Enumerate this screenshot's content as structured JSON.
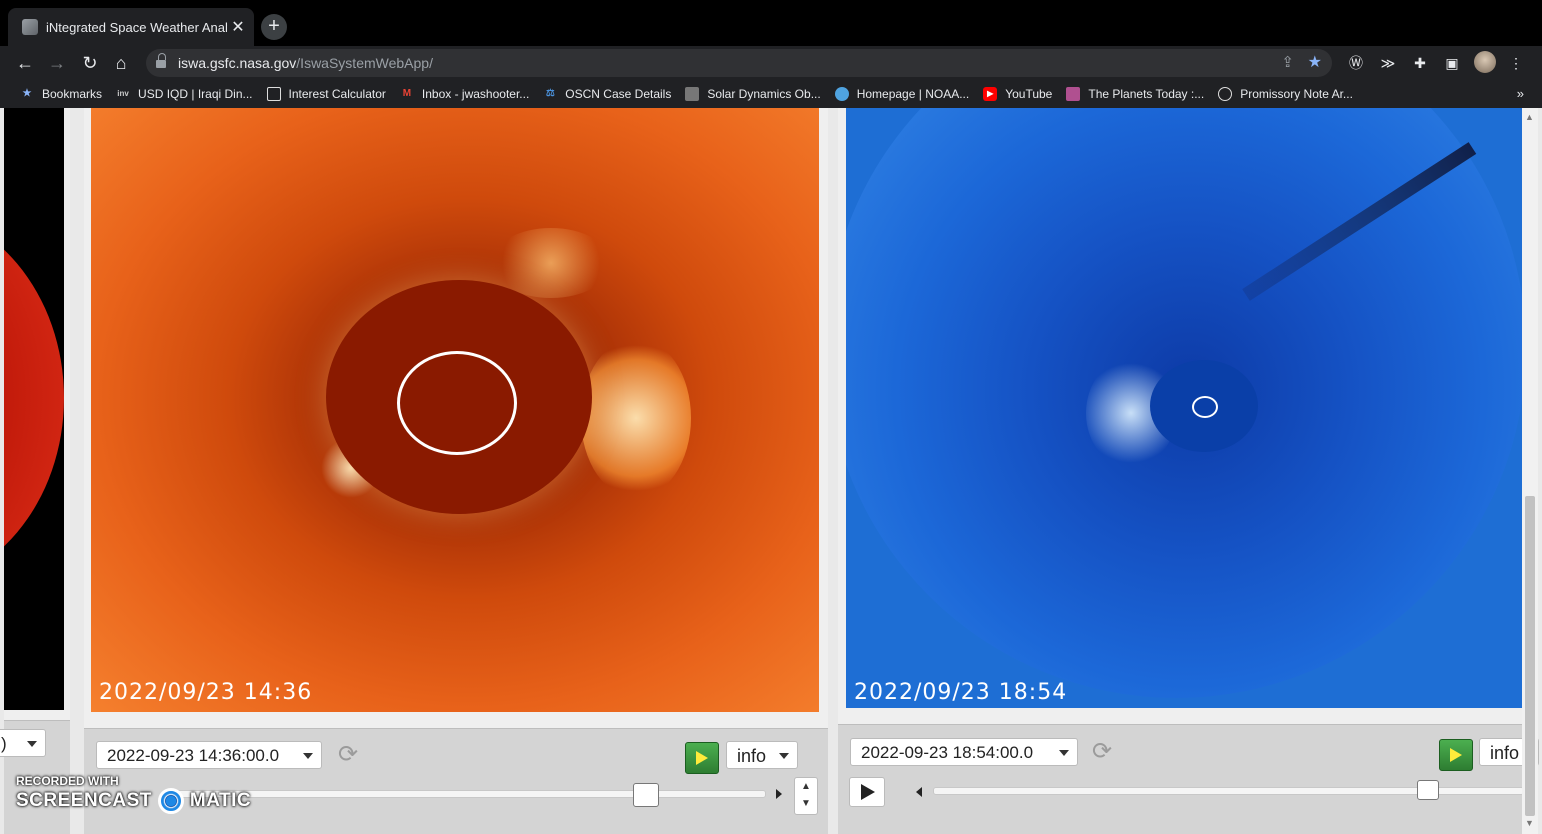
{
  "browser": {
    "tab_title": "iNtegrated Space Weather Analy",
    "url_host": "iswa.gsfc.nasa.gov",
    "url_path": "/IswaSystemWebApp/",
    "bookmarks": [
      {
        "label": "Bookmarks",
        "icon": "star-icon",
        "color": "#8ab4f8"
      },
      {
        "label": "USD IQD | Iraqi Din...",
        "icon": "inv-icon",
        "color": "#cccccc"
      },
      {
        "label": "Interest Calculator",
        "icon": "calculator-icon",
        "color": "#dddddd"
      },
      {
        "label": "Inbox - jwashooter...",
        "icon": "gmail-icon",
        "color": "#ea4335"
      },
      {
        "label": "OSCN Case Details",
        "icon": "oscn-icon",
        "color": "#4a90d9"
      },
      {
        "label": "Solar Dynamics Ob...",
        "icon": "sdo-icon",
        "color": "#aaaaaa"
      },
      {
        "label": "Homepage | NOAA...",
        "icon": "noaa-icon",
        "color": "#4fa3e0"
      },
      {
        "label": "YouTube",
        "icon": "youtube-icon",
        "color": "#ff0000"
      },
      {
        "label": "The Planets Today :...",
        "icon": "planets-icon",
        "color": "#b05090"
      },
      {
        "label": "Promissory Note Ar...",
        "icon": "document-icon",
        "color": "#dddddd"
      }
    ],
    "more": "»"
  },
  "panels": {
    "left": {
      "date_fragment": ")"
    },
    "red": {
      "timestamp": "2022/09/23 14:36",
      "date_value": "2022-09-23 14:36:00.0",
      "info_label": "info"
    },
    "blue": {
      "timestamp": "2022/09/23 18:54",
      "date_value": "2022-09-23 18:54:00.0",
      "info_label": "info"
    }
  },
  "watermark": {
    "line1": "RECORDED WITH",
    "line2a": "SCREENCAST",
    "line2b": "MATIC"
  }
}
